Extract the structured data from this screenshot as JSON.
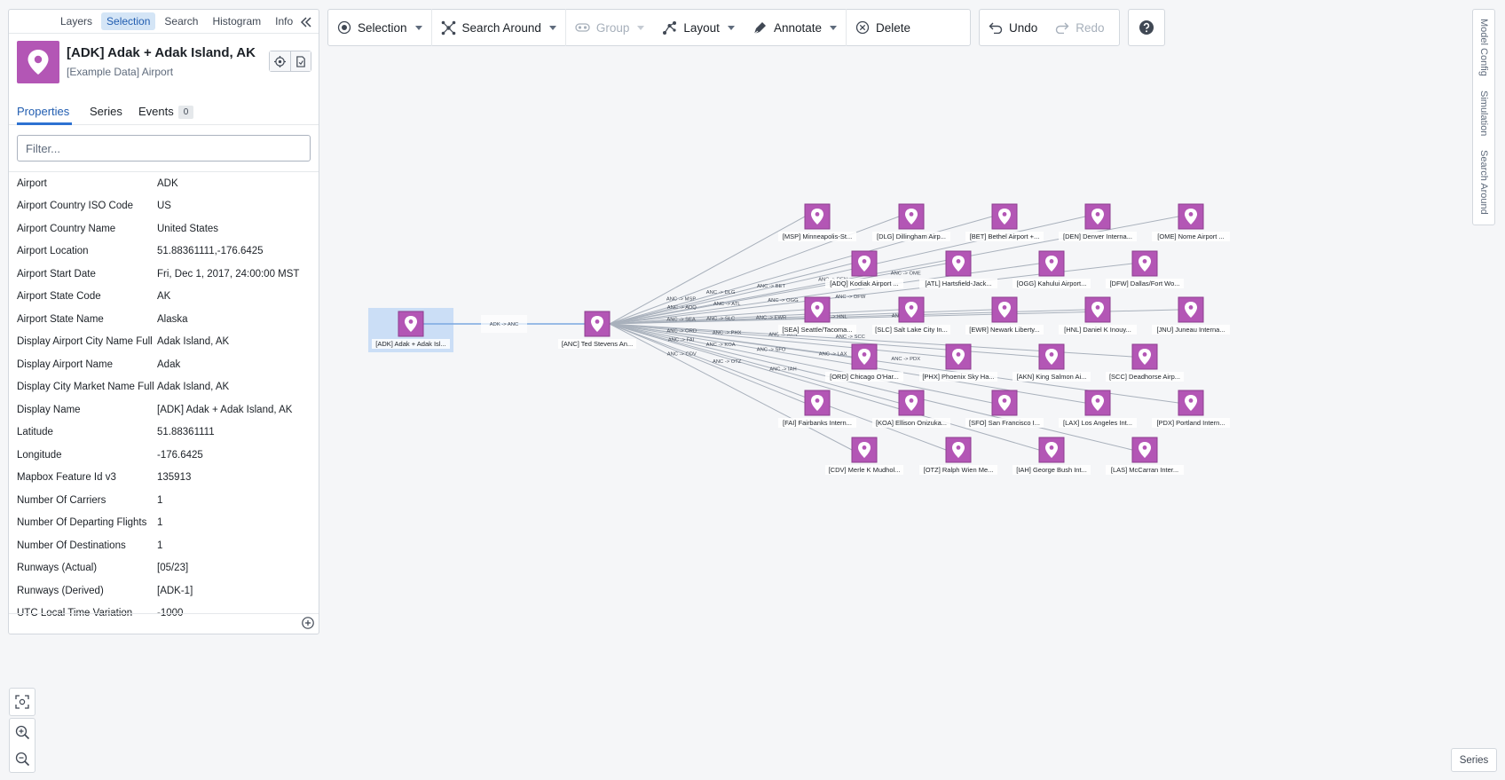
{
  "panel": {
    "tabs": [
      "Layers",
      "Selection",
      "Search",
      "Histogram",
      "Info"
    ],
    "active_tab": "Selection",
    "title": "[ADK] Adak + Adak Island, AK",
    "subtitle": "[Example Data] Airport",
    "subtabs": {
      "properties": "Properties",
      "series": "Series",
      "events": "Events",
      "events_count": "0"
    },
    "filter_placeholder": "Filter...",
    "properties": [
      {
        "key": "Airport",
        "value": "ADK"
      },
      {
        "key": "Airport Country ISO Code",
        "value": "US"
      },
      {
        "key": "Airport Country Name",
        "value": "United States"
      },
      {
        "key": "Airport Location",
        "value": "51.88361111,-176.6425"
      },
      {
        "key": "Airport Start Date",
        "value": "Fri, Dec 1, 2017, 24:00:00 MST"
      },
      {
        "key": "Airport State Code",
        "value": "AK"
      },
      {
        "key": "Airport State Name",
        "value": "Alaska"
      },
      {
        "key": "Display Airport City Name Full",
        "value": "Adak Island, AK"
      },
      {
        "key": "Display Airport Name",
        "value": "Adak"
      },
      {
        "key": "Display City Market Name Full",
        "value": "Adak Island, AK"
      },
      {
        "key": "Display Name",
        "value": "[ADK] Adak + Adak Island, AK"
      },
      {
        "key": "Latitude",
        "value": "51.88361111"
      },
      {
        "key": "Longitude",
        "value": "-176.6425"
      },
      {
        "key": "Mapbox Feature Id v3",
        "value": "135913"
      },
      {
        "key": "Number Of Carriers",
        "value": "1"
      },
      {
        "key": "Number Of Departing Flights",
        "value": "1"
      },
      {
        "key": "Number Of Destinations",
        "value": "1"
      },
      {
        "key": "Runways (Actual)",
        "value": "[05/23]"
      },
      {
        "key": "Runways (Derived)",
        "value": "[ADK-1]"
      },
      {
        "key": "UTC Local Time Variation",
        "value": "-1000"
      }
    ]
  },
  "toolbar": {
    "selection": "Selection",
    "search_around": "Search Around",
    "group": "Group",
    "layout": "Layout",
    "annotate": "Annotate",
    "delete": "Delete",
    "undo": "Undo",
    "redo": "Redo"
  },
  "rail": [
    "Model Config",
    "Simulation",
    "Search Around"
  ],
  "series_button": "Series",
  "colors": {
    "node": "#b356b5",
    "accent": "#2d72d2",
    "selection": "#c6dbf5"
  },
  "graph": {
    "source": {
      "label": "[ADK] Adak + Adak Isl...",
      "edge": "ADK -> ANC"
    },
    "hub": {
      "label": "[ANC] Ted Stevens An..."
    },
    "destinations": [
      {
        "label": "[MSP] Minneapolis-St...",
        "edge": "ANC -> MSP"
      },
      {
        "label": "[DLG] Dillingham Airp...",
        "edge": "ANC -> DLG"
      },
      {
        "label": "[BET] Bethel Airport +...",
        "edge": "ANC -> BET"
      },
      {
        "label": "[DEN] Denver Interna...",
        "edge": "ANC -> DEN"
      },
      {
        "label": "[OME] Nome Airport ...",
        "edge": "ANC -> OME"
      },
      {
        "label": "[ADQ] Kodiak Airport ...",
        "edge": "ANC -> ADQ"
      },
      {
        "label": "[ATL] Hartsfield-Jack...",
        "edge": "ANC -> ATL"
      },
      {
        "label": "[OGG] Kahului Airport...",
        "edge": "ANC -> OGG"
      },
      {
        "label": "[DFW] Dallas/Fort Wo...",
        "edge": "ANC -> DFW"
      },
      {
        "label": "[SEA] Seattle/Tacoma...",
        "edge": "ANC -> SEA"
      },
      {
        "label": "[SLC] Salt Lake City In...",
        "edge": "ANC -> SLC"
      },
      {
        "label": "[EWR] Newark Liberty...",
        "edge": "ANC -> EWR"
      },
      {
        "label": "[HNL] Daniel K Inouy...",
        "edge": "ANC -> HNL"
      },
      {
        "label": "[JNU] Juneau Interna...",
        "edge": "ANC -> JNU"
      },
      {
        "label": "[ORD] Chicago O'Har...",
        "edge": "ANC -> ORD"
      },
      {
        "label": "[PHX] Phoenix Sky Ha...",
        "edge": "ANC -> PHX"
      },
      {
        "label": "[AKN] King Salmon Ai...",
        "edge": "ANC -> AKN"
      },
      {
        "label": "[SCC] Deadhorse Airp...",
        "edge": "ANC -> SCC"
      },
      {
        "label": "[FAI] Fairbanks Intern...",
        "edge": "ANC -> FAI"
      },
      {
        "label": "[KOA] Ellison Onizuka...",
        "edge": "ANC -> KOA"
      },
      {
        "label": "[SFO] San Francisco I...",
        "edge": "ANC -> SFO"
      },
      {
        "label": "[LAX] Los Angeles Int...",
        "edge": "ANC -> LAX"
      },
      {
        "label": "[PDX] Portland Intern...",
        "edge": "ANC -> PDX"
      },
      {
        "label": "[CDV] Merle K Mudhol...",
        "edge": "ANC -> CDV"
      },
      {
        "label": "[OTZ] Ralph Wien Me...",
        "edge": "ANC -> OTZ"
      },
      {
        "label": "[IAH] George Bush Int...",
        "edge": "ANC -> IAH"
      },
      {
        "label": "[LAS] McCarran Inter...",
        "edge": "ANC -> LAS"
      }
    ]
  }
}
